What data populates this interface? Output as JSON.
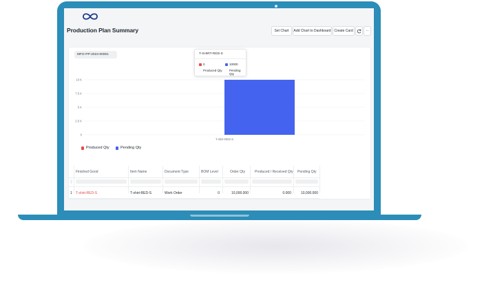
{
  "header": {
    "title": "Production Plan Summary",
    "buttons": {
      "set_chart": "Set Chart",
      "add_chart": "Add Chart to Dashboard",
      "create_card": "Create Card",
      "refresh_icon": "refresh-icon",
      "more_icon": "more-icon"
    }
  },
  "filter": {
    "production_plan": "MFG-PP-2024-00001"
  },
  "tooltip": {
    "title": "T-SHIRT-RED-S",
    "items": [
      {
        "value": "0",
        "label": "Produced Qty"
      },
      {
        "value": "10000",
        "label": "Pending Qty"
      }
    ]
  },
  "chart_data": {
    "type": "bar",
    "categories": [
      "T-shirt-RED-S"
    ],
    "series": [
      {
        "name": "Produced Qty",
        "values": [
          0
        ],
        "color": "#e24c4c"
      },
      {
        "name": "Pending Qty",
        "values": [
          10000
        ],
        "color": "#4463ee"
      }
    ],
    "y_ticks": [
      "0",
      "2.5 K",
      "5 K",
      "7.5 K",
      "10 K"
    ],
    "ylim": [
      0,
      10000
    ],
    "legend_position": "bottom-left",
    "grid": true
  },
  "legend": [
    {
      "label": "Produced Qty",
      "color": "#e24c4c"
    },
    {
      "label": "Pending Qty",
      "color": "#4463ee"
    }
  ],
  "table": {
    "columns": [
      "Finished Good",
      "Item Name",
      "Document Type",
      "BOM Level",
      "Order Qty",
      "Produced / Received Qty",
      "Pending Qty"
    ],
    "rows": [
      {
        "index": "1",
        "finished_good": "T-shirt-RED-S",
        "item_name": "T-shirt-RED-S",
        "document_type": "Work Order",
        "bom_level": "0",
        "order_qty": "10,000.000",
        "produced_qty": "0.000",
        "pending_qty": "10,000.000"
      }
    ]
  }
}
